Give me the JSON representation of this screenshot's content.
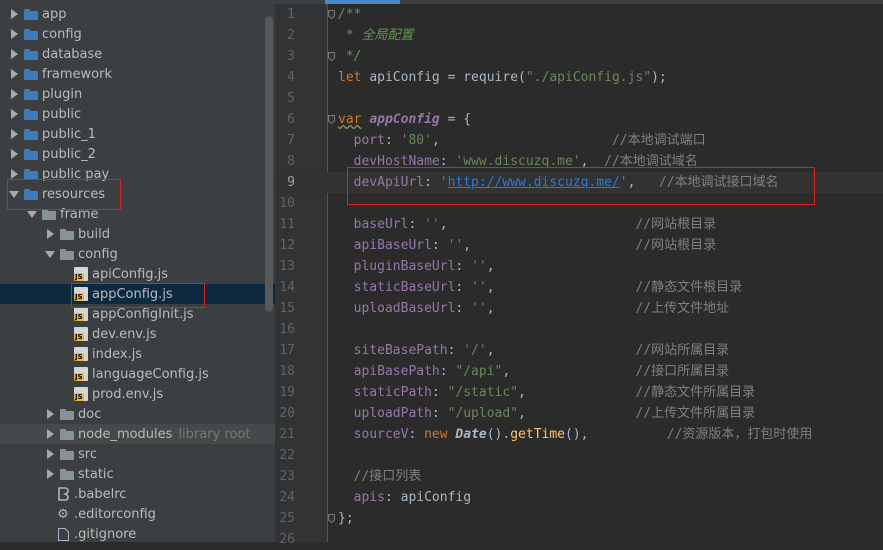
{
  "tree": {
    "items": [
      {
        "label": "app",
        "indent": 0,
        "type": "folder",
        "expanded": false
      },
      {
        "label": "config",
        "indent": 0,
        "type": "folder",
        "expanded": false
      },
      {
        "label": "database",
        "indent": 0,
        "type": "folder",
        "expanded": false
      },
      {
        "label": "framework",
        "indent": 0,
        "type": "folder",
        "expanded": false
      },
      {
        "label": "plugin",
        "indent": 0,
        "type": "folder",
        "expanded": false
      },
      {
        "label": "public",
        "indent": 0,
        "type": "folder",
        "expanded": false
      },
      {
        "label": "public_1",
        "indent": 0,
        "type": "folder",
        "expanded": false
      },
      {
        "label": "public_2",
        "indent": 0,
        "type": "folder",
        "expanded": false
      },
      {
        "label": "public pay",
        "indent": 0,
        "type": "folder",
        "expanded": false
      },
      {
        "label": "resources",
        "indent": 0,
        "type": "folder",
        "expanded": true
      },
      {
        "label": "frame",
        "indent": 1,
        "type": "folder",
        "expanded": true
      },
      {
        "label": "build",
        "indent": 2,
        "type": "folder",
        "expanded": false
      },
      {
        "label": "config",
        "indent": 2,
        "type": "folder",
        "expanded": true
      },
      {
        "label": "apiConfig.js",
        "indent": 3,
        "type": "js"
      },
      {
        "label": "appConfig.js",
        "indent": 3,
        "type": "js",
        "selected": true
      },
      {
        "label": "appConfigInit.js",
        "indent": 3,
        "type": "js"
      },
      {
        "label": "dev.env.js",
        "indent": 3,
        "type": "js"
      },
      {
        "label": "index.js",
        "indent": 3,
        "type": "js"
      },
      {
        "label": "languageConfig.js",
        "indent": 3,
        "type": "js"
      },
      {
        "label": "prod.env.js",
        "indent": 3,
        "type": "js"
      },
      {
        "label": "doc",
        "indent": 2,
        "type": "folder",
        "expanded": false
      },
      {
        "label": "node_modules",
        "indent": 2,
        "type": "folder",
        "expanded": false,
        "suffix": "library root",
        "excluded": true
      },
      {
        "label": "src",
        "indent": 2,
        "type": "folder",
        "expanded": false
      },
      {
        "label": "static",
        "indent": 2,
        "type": "folder",
        "expanded": false
      },
      {
        "label": ".babelrc",
        "indent": 2,
        "type": "babel"
      },
      {
        "label": ".editorconfig",
        "indent": 2,
        "type": "gear"
      },
      {
        "label": ".gitignore",
        "indent": 2,
        "type": "file"
      }
    ]
  },
  "editor": {
    "current_line": 9,
    "lines": [
      {
        "n": "1",
        "tokens": [
          [
            "cd",
            "/**"
          ]
        ],
        "fold": true
      },
      {
        "n": "2",
        "tokens": [
          [
            "cd",
            " * 全局配置"
          ]
        ]
      },
      {
        "n": "3",
        "tokens": [
          [
            "cd",
            " */"
          ]
        ],
        "fold": true
      },
      {
        "n": "4",
        "tokens": [
          [
            "k",
            "let "
          ],
          [
            "pl",
            "apiConfig = "
          ],
          [
            "pl",
            "require("
          ],
          [
            "s",
            "\"./apiConfig.js\""
          ],
          [
            "pl",
            ");"
          ]
        ]
      },
      {
        "n": "5",
        "tokens": []
      },
      {
        "n": "6",
        "tokens": [
          [
            "kw",
            "var"
          ],
          [
            "pl",
            " "
          ],
          [
            "v",
            "appConfig"
          ],
          [
            "pl",
            " = {"
          ]
        ],
        "fold": true
      },
      {
        "n": "7",
        "tokens": [
          [
            "p",
            "  port"
          ],
          [
            "pl",
            ": "
          ],
          [
            "s",
            "'80'"
          ],
          [
            "pl",
            ",                      "
          ],
          [
            "c",
            "//本地调试端口"
          ]
        ]
      },
      {
        "n": "8",
        "tokens": [
          [
            "p",
            "  devHostName"
          ],
          [
            "pl",
            ": "
          ],
          [
            "s",
            "'www.discuzq.me'"
          ],
          [
            "pl",
            ",  "
          ],
          [
            "c",
            "//本地调试域名"
          ]
        ]
      },
      {
        "n": "9",
        "tokens": [
          [
            "p",
            "  devApiUrl"
          ],
          [
            "pl",
            ": "
          ],
          [
            "s",
            "'"
          ],
          [
            "sl",
            "http://www.discuzq.me/"
          ],
          [
            "s",
            "'"
          ],
          [
            "pl",
            ",   "
          ],
          [
            "c",
            "//本地调试接口域名"
          ]
        ]
      },
      {
        "n": "10",
        "tokens": []
      },
      {
        "n": "11",
        "tokens": [
          [
            "p",
            "  baseUrl"
          ],
          [
            "pl",
            ": "
          ],
          [
            "s",
            "''"
          ],
          [
            "pl",
            ",                        "
          ],
          [
            "c",
            "//网站根目录"
          ]
        ]
      },
      {
        "n": "12",
        "tokens": [
          [
            "p",
            "  apiBaseUrl"
          ],
          [
            "pl",
            ": "
          ],
          [
            "s",
            "''"
          ],
          [
            "pl",
            ",                     "
          ],
          [
            "c",
            "//网站根目录"
          ]
        ]
      },
      {
        "n": "13",
        "tokens": [
          [
            "p",
            "  pluginBaseUrl"
          ],
          [
            "pl",
            ": "
          ],
          [
            "s",
            "''"
          ],
          [
            "pl",
            ","
          ]
        ]
      },
      {
        "n": "14",
        "tokens": [
          [
            "p",
            "  staticBaseUrl"
          ],
          [
            "pl",
            ": "
          ],
          [
            "s",
            "''"
          ],
          [
            "pl",
            ",                  "
          ],
          [
            "c",
            "//静态文件根目录"
          ]
        ]
      },
      {
        "n": "15",
        "tokens": [
          [
            "p",
            "  uploadBaseUrl"
          ],
          [
            "pl",
            ": "
          ],
          [
            "s",
            "''"
          ],
          [
            "pl",
            ",                  "
          ],
          [
            "c",
            "//上传文件地址"
          ]
        ]
      },
      {
        "n": "16",
        "tokens": []
      },
      {
        "n": "17",
        "tokens": [
          [
            "p",
            "  siteBasePath"
          ],
          [
            "pl",
            ": "
          ],
          [
            "s",
            "'/'"
          ],
          [
            "pl",
            ",                  "
          ],
          [
            "c",
            "//网站所属目录"
          ]
        ]
      },
      {
        "n": "18",
        "tokens": [
          [
            "p",
            "  apiBasePath"
          ],
          [
            "pl",
            ": "
          ],
          [
            "s",
            "\"/api\""
          ],
          [
            "pl",
            ",                "
          ],
          [
            "c",
            "//接口所属目录"
          ]
        ]
      },
      {
        "n": "19",
        "tokens": [
          [
            "p",
            "  staticPath"
          ],
          [
            "pl",
            ": "
          ],
          [
            "s",
            "\"/static\""
          ],
          [
            "pl",
            ",              "
          ],
          [
            "c",
            "//静态文件所属目录"
          ]
        ]
      },
      {
        "n": "20",
        "tokens": [
          [
            "p",
            "  uploadPath"
          ],
          [
            "pl",
            ": "
          ],
          [
            "s",
            "\"/upload\""
          ],
          [
            "pl",
            ",              "
          ],
          [
            "c",
            "//上传文件所属目录"
          ]
        ]
      },
      {
        "n": "21",
        "tokens": [
          [
            "p",
            "  sourceV"
          ],
          [
            "pl",
            ": "
          ],
          [
            "k",
            "new "
          ],
          [
            "cls",
            "Date"
          ],
          [
            "pl",
            "()."
          ],
          [
            "f",
            "getTime"
          ],
          [
            "pl",
            "(),          "
          ],
          [
            "c",
            "//资源版本，打包时使用"
          ]
        ]
      },
      {
        "n": "22",
        "tokens": []
      },
      {
        "n": "23",
        "tokens": [
          [
            "c",
            "  //接口列表"
          ]
        ]
      },
      {
        "n": "24",
        "tokens": [
          [
            "p",
            "  apis"
          ],
          [
            "pl",
            ": apiConfig"
          ]
        ]
      },
      {
        "n": "25",
        "tokens": [
          [
            "pl",
            "};"
          ]
        ],
        "fold": true
      },
      {
        "n": "26",
        "tokens": []
      }
    ]
  },
  "colors": {
    "tree_bg": "#3c3f41",
    "editor_bg": "#2b2b2b",
    "gutter_bg": "#313335",
    "selection": "#0d293e",
    "highlight_box": "#e02020",
    "accent": "#4a88c7"
  }
}
